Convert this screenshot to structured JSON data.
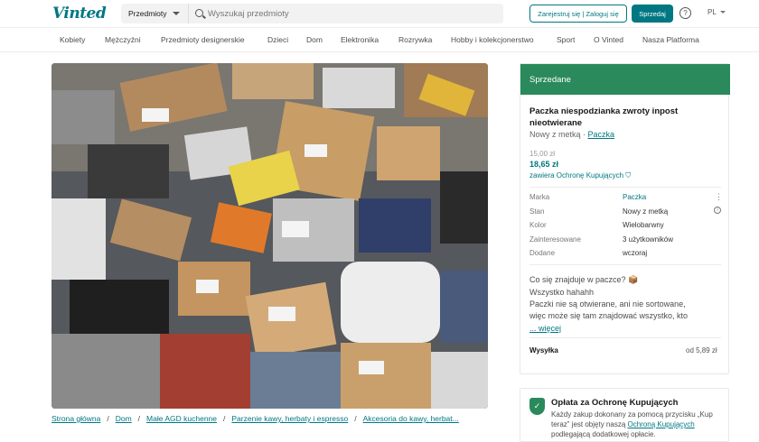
{
  "header": {
    "logo": "Vinted",
    "category_select": "Przedmioty",
    "search_placeholder": "Wyszukaj przedmioty",
    "login_label": "Zarejestruj się | Zaloguj się",
    "sell_label": "Sprzedaj",
    "help_glyph": "?",
    "language": "PL"
  },
  "categories": [
    "Kobiety",
    "Mężczyźni",
    "Przedmioty designerskie",
    "Dzieci",
    "Dom",
    "Elektronika",
    "Rozrywka",
    "Hobby i kolekcjonerstwo",
    "Sport",
    "O Vinted",
    "Nasza Platforma"
  ],
  "photo": {
    "likes": "6"
  },
  "breadcrumb": [
    "Strona główna",
    "Dom",
    "Małe AGD kuchenne",
    "Parzenie kawy, herbaty i espresso",
    "Akcesoria do kawy, herbat..."
  ],
  "item": {
    "status_banner": "Sprzedane",
    "title": "Paczka niespodzianka zwroty inpost nieotwierane",
    "condition": "Nowy z metką",
    "condition_sep": " · ",
    "brand": "Paczka",
    "price_original": "15,00 zł",
    "price_with_protection": "18,65 zł",
    "protection_note": "zawiera Ochronę Kupujących",
    "details": [
      {
        "label": "Marka",
        "value": "Paczka"
      },
      {
        "label": "Stan",
        "value": "Nowy z metką"
      },
      {
        "label": "Kolor",
        "value": "Wielobarwny"
      },
      {
        "label": "Zainteresowane",
        "value": "3 użytkowników"
      },
      {
        "label": "Dodane",
        "value": "wczoraj"
      }
    ],
    "description_lines": [
      "Co się znajduje w paczce? 📦",
      "Wszystko hahahh",
      "Paczki nie są otwierane, ani nie sortowane,",
      "więc może się tam znajdować wszystko, kto"
    ],
    "more_label": "... więcej",
    "shipping_label": "Wysyłka",
    "shipping_value": "od 5,89 zł"
  },
  "protection_box": {
    "title": "Opłata za Ochronę Kupujących",
    "text_before": "Każdy zakup dokonany za pomocą przycisku „Kup teraz” jest objęty naszą ",
    "link": "Ochroną Kupujących",
    "text_after": " podlegającą dodatkowej opłacie."
  },
  "colors": {
    "brand": "#007782",
    "sold_banner": "#2b8a5c"
  }
}
